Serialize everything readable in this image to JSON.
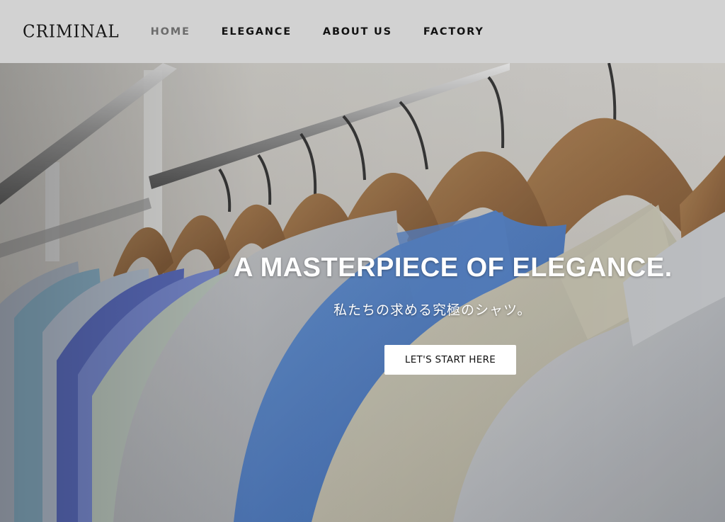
{
  "header": {
    "logo": "CRIMINAL",
    "nav": [
      {
        "label": "HOME",
        "active": true
      },
      {
        "label": "ELEGANCE",
        "active": false
      },
      {
        "label": "ABOUT US",
        "active": false
      },
      {
        "label": "FACTORY",
        "active": false
      }
    ]
  },
  "hero": {
    "title": "A MASTERPIECE OF ELEGANCE.",
    "subtitle": "私たちの求める究極のシャツ。",
    "cta_label": "LET'S START HERE",
    "image_description": "shirts-on-wooden-hangers-photo"
  },
  "colors": {
    "header_bg": "#d2d2d2",
    "nav_active": "#6c6c6c",
    "nav_text": "#121212",
    "hero_text": "#ffffff",
    "button_bg": "#ffffff"
  }
}
